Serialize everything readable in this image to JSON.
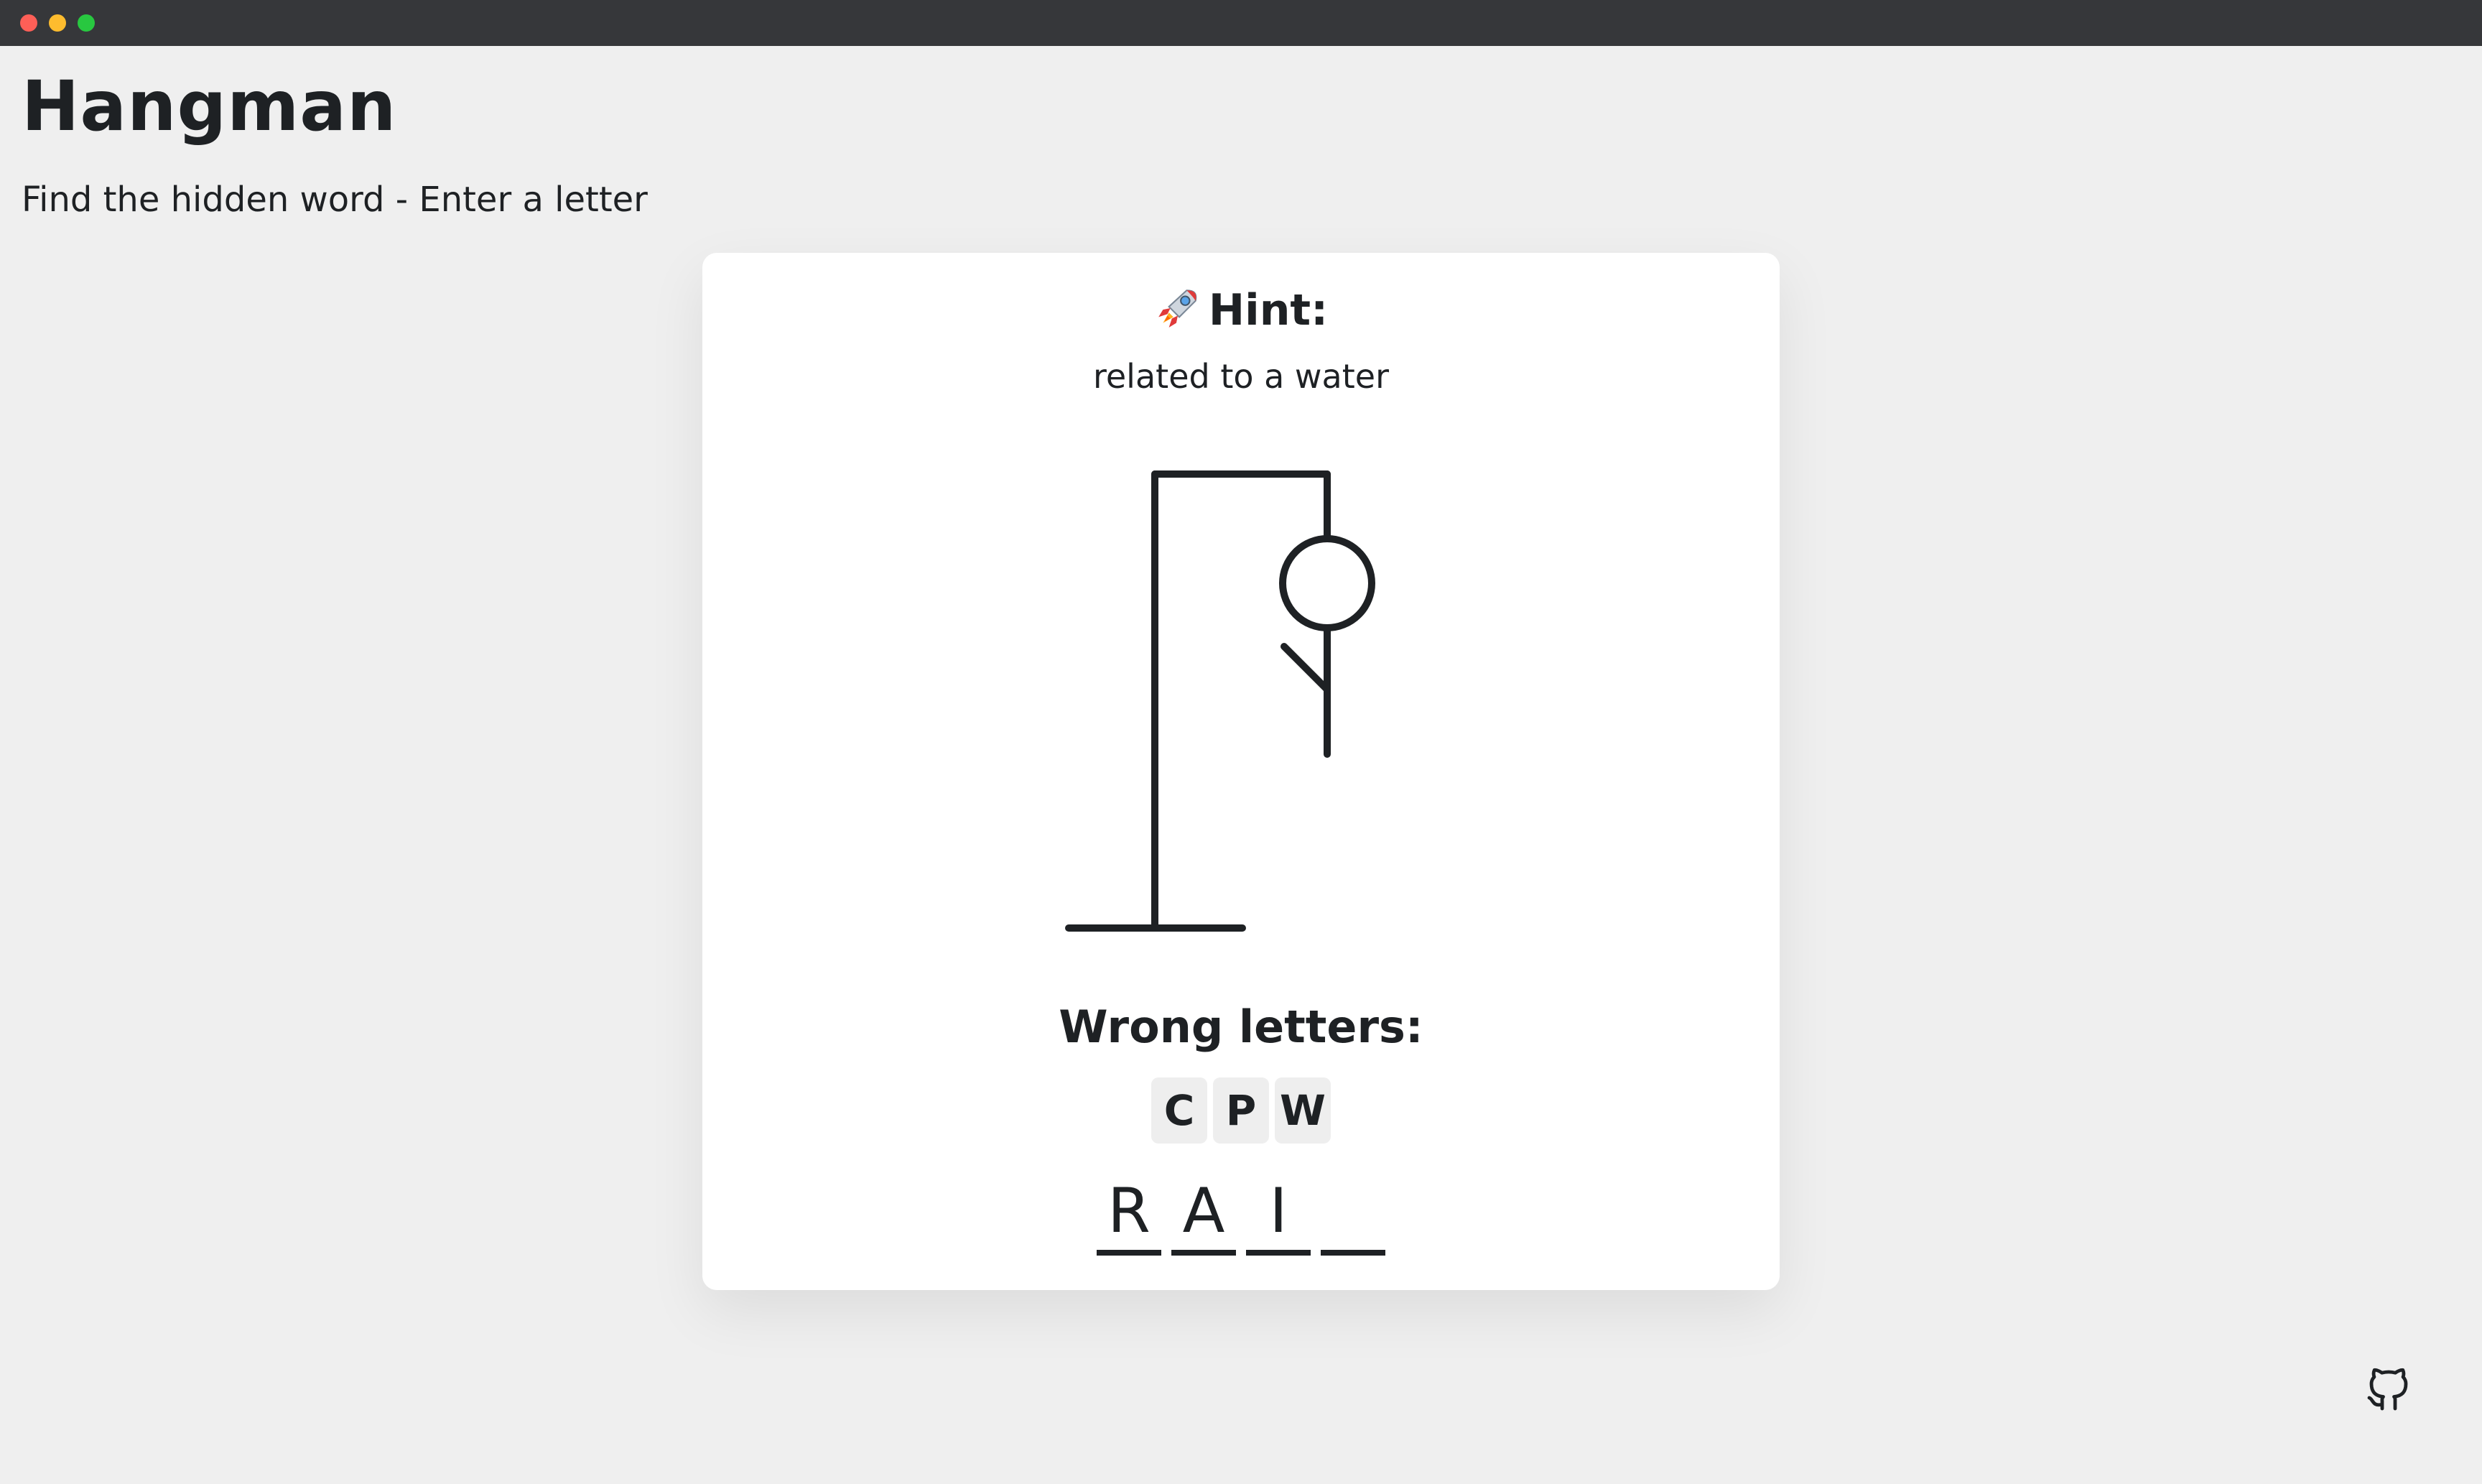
{
  "app": {
    "title": "Hangman",
    "subtitle": "Find the hidden word - Enter a letter"
  },
  "hint": {
    "label": "Hint:",
    "icon": "rocket-icon",
    "text": "related to a water"
  },
  "game": {
    "wrong_label": "Wrong letters:",
    "wrong_letters": [
      "C",
      "P",
      "W"
    ],
    "word_slots": [
      "R",
      "A",
      "I",
      ""
    ],
    "figure_parts_shown": [
      "head",
      "body",
      "left-arm"
    ]
  },
  "footer": {
    "github_icon": "github-icon"
  },
  "colors": {
    "background": "#efefef",
    "card": "#ffffff",
    "ink": "#1e2124",
    "titlebar": "#36373a",
    "letter_chip": "#eeeeee"
  }
}
